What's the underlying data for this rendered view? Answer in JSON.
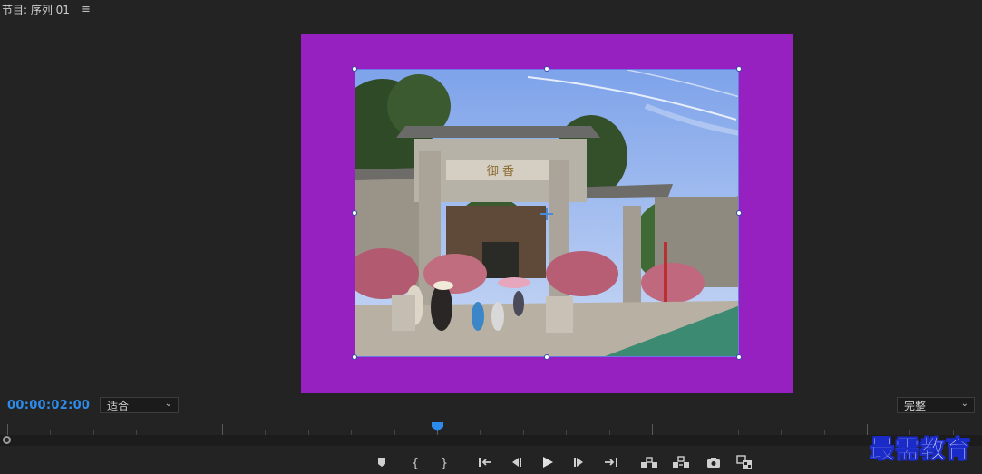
{
  "panel": {
    "title": "节目: 序列 01",
    "menu_icon": "hamburger-menu-icon"
  },
  "colors": {
    "canvas_background": "#9620c0",
    "timecode": "#2d8ceb",
    "selection": "#6a78e6"
  },
  "playback": {
    "timecode": "00:00:02:00"
  },
  "zoom_select": {
    "value": "适合"
  },
  "quality_select": {
    "value": "完整"
  },
  "transport_icons": [
    "add-marker-icon",
    "mark-in-icon",
    "mark-out-icon",
    "go-to-in-icon",
    "step-back-icon",
    "play-icon",
    "step-forward-icon",
    "go-to-out-icon",
    "lift-icon",
    "extract-icon",
    "export-frame-icon",
    "compare-view-icon"
  ],
  "watermark": {
    "text": "最需教育"
  }
}
